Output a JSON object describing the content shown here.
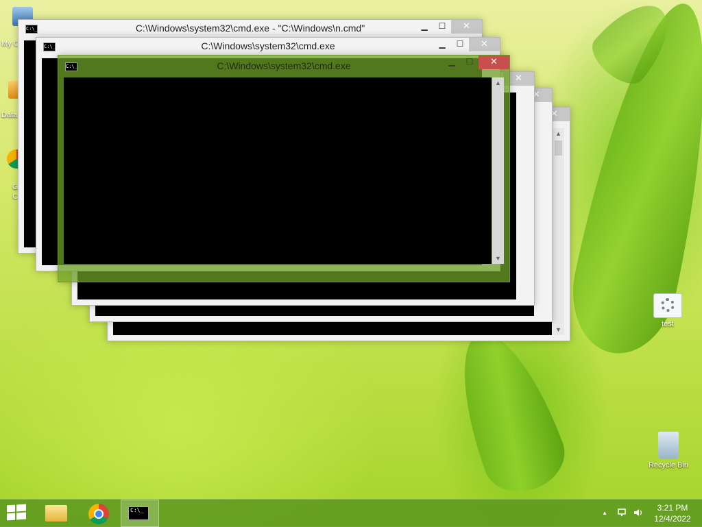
{
  "desktop": {
    "icons": [
      {
        "label": "My C",
        "icon": "computer-icon"
      },
      {
        "label": "Data",
        "icon": "shortcut-icon"
      },
      {
        "label": "G\nC",
        "icon": "chrome-shortcut-icon"
      },
      {
        "label": "test",
        "icon": "settings-file-icon"
      },
      {
        "label": "Recycle Bin",
        "icon": "recycle-bin-icon"
      }
    ]
  },
  "windows": [
    {
      "title": "C:\\Windows\\system32\\cmd.exe - \"C:\\Windows\\n.cmd\""
    },
    {
      "title": "C:\\Windows\\system32\\cmd.exe"
    },
    {
      "title": "C:\\Windows\\system32\\cmd.exe"
    }
  ],
  "window_buttons": {
    "minimize": "▁",
    "maximize": "☐",
    "close": "✕"
  },
  "taskbar": {
    "start": "start-logo-icon",
    "pinned": [
      "file-explorer-icon",
      "chrome-icon",
      "cmd-icon"
    ],
    "tray": {
      "show_hidden": "▲",
      "network": "network-icon",
      "volume": "volume-icon"
    },
    "time": "3:21 PM",
    "date": "12/4/2022"
  },
  "colors": {
    "active_window": "#6ea028",
    "close_active": "#c94f4f",
    "taskbar": "#5a961e"
  }
}
